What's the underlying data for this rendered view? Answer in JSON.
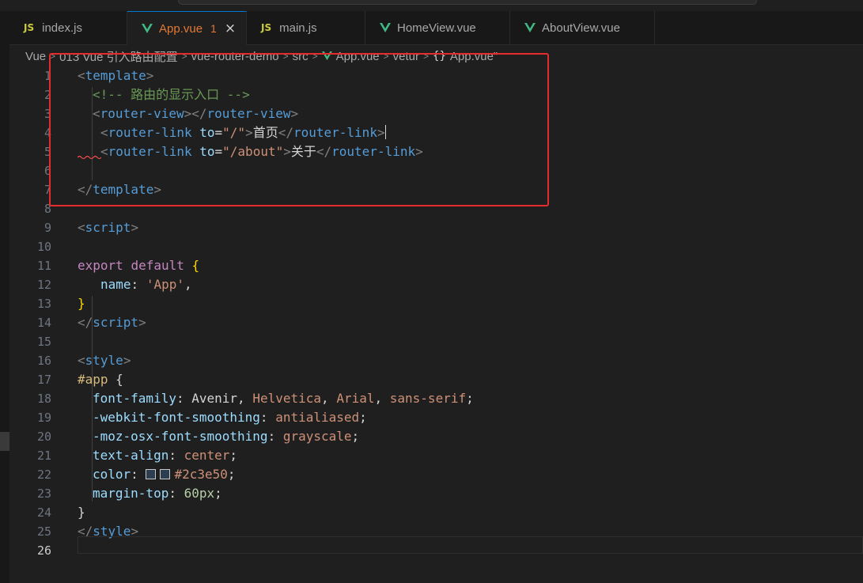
{
  "colors": {
    "accent": "#0078d4",
    "modified": "#e37933",
    "highlight": "#e52b2b",
    "vue_green": "#41b883"
  },
  "tabs": [
    {
      "icon": "js-icon",
      "prefix": "JS",
      "label": "index.js"
    },
    {
      "icon": "vue-icon",
      "label": "App.vue",
      "badge": "1",
      "close": "×",
      "active": true
    },
    {
      "icon": "js-icon",
      "prefix": "JS",
      "label": "main.js"
    },
    {
      "icon": "vue-icon",
      "label": "HomeView.vue"
    },
    {
      "icon": "vue-icon",
      "label": "AboutView.vue"
    }
  ],
  "breadcrumb": {
    "separator": ">",
    "items": [
      "Vue",
      "013 Vue 引入路由配置",
      "vue-router-demo",
      "src",
      "App.vue",
      "vetur",
      "App.vue\""
    ],
    "brace": "{}"
  },
  "lines": {
    "n1": "1",
    "n2": "2",
    "n3": "3",
    "n4": "4",
    "n5": "5",
    "n6": "6",
    "n7": "7",
    "n8": "8",
    "n9": "9",
    "n10": "10",
    "n11": "11",
    "n12": "12",
    "n13": "13",
    "n14": "14",
    "n15": "15",
    "n16": "16",
    "n17": "17",
    "n18": "18",
    "n19": "19",
    "n20": "20",
    "n21": "21",
    "n22": "22",
    "n23": "23",
    "n24": "24",
    "n25": "25",
    "n26": "26"
  },
  "code": {
    "lt": "<",
    "gt": ">",
    "lts": "</",
    "eq": "=",
    "template": "template",
    "router_view": "router-view",
    "router_link": "router-link",
    "comment": "<!-- 路由的显示入口 -->",
    "to": "to",
    "str_root": "\"/\"",
    "str_about": "\"/about\"",
    "home": "首页",
    "about": "关于",
    "script": "script",
    "style": "style",
    "export": "export",
    "default": "default",
    "lbrace": "{",
    "rbrace": "}",
    "name_key": "name",
    "colon": ":",
    "app_str": "'App'",
    "comma": ",",
    "sel_app": "#app",
    "p_font": "font-family",
    "v_font1": "Avenir",
    "v_font2": "Helvetica",
    "v_font3": "Arial",
    "v_font4": "sans-serif",
    "p_webkit": "-webkit-font-smoothing",
    "v_webkit": "antialiased",
    "p_moz": "-moz-osx-font-smoothing",
    "v_moz": "grayscale",
    "p_align": "text-align",
    "v_align": "center",
    "p_color": "color",
    "v_color": "#2c3e50",
    "p_margin": "margin-top",
    "v_margin": "60px",
    "semi": ";",
    "sp": " "
  }
}
